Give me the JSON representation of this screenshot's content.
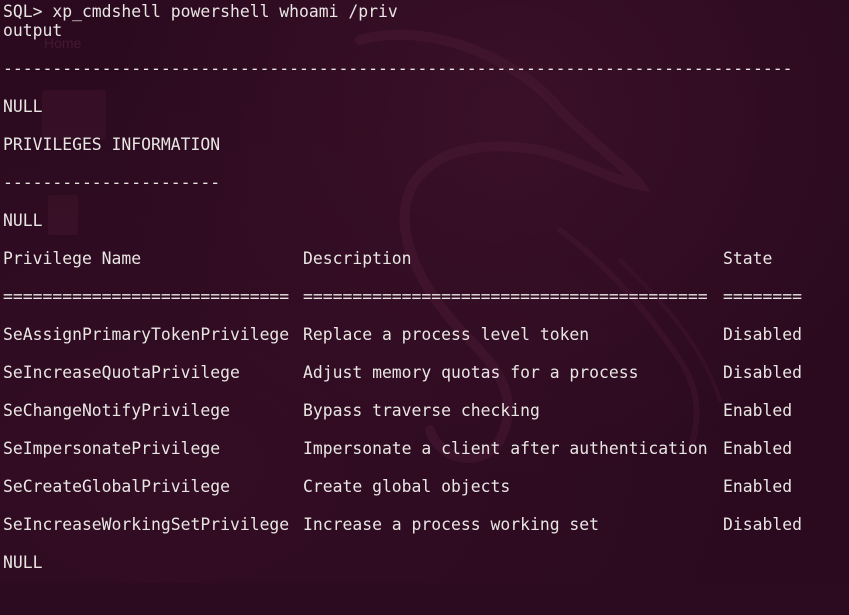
{
  "desktop": {
    "home_label": "Home"
  },
  "terminal": {
    "prompt": "SQL> xp_cmdshell powershell whoami /priv",
    "output_header": "output",
    "dash_long": "--------------------------------------------------------------------------------",
    "null_1": "NULL",
    "priv_info_title": "PRIVILEGES INFORMATION",
    "dash_short": "----------------------",
    "null_2": "NULL",
    "columns": {
      "name": "Privilege Name",
      "description": "Description",
      "state": "State"
    },
    "separators": {
      "name": "=============================",
      "description": "=========================================",
      "state": "========"
    },
    "rows": [
      {
        "name": "SeAssignPrimaryTokenPrivilege",
        "description": "Replace a process level token",
        "state": "Disabled"
      },
      {
        "name": "SeIncreaseQuotaPrivilege",
        "description": "Adjust memory quotas for a process",
        "state": "Disabled"
      },
      {
        "name": "SeChangeNotifyPrivilege",
        "description": "Bypass traverse checking",
        "state": "Enabled"
      },
      {
        "name": "SeImpersonatePrivilege",
        "description": "Impersonate a client after authentication",
        "state": "Enabled"
      },
      {
        "name": "SeCreateGlobalPrivilege",
        "description": "Create global objects",
        "state": "Enabled"
      },
      {
        "name": "SeIncreaseWorkingSetPrivilege",
        "description": "Increase a process working set",
        "state": "Disabled"
      }
    ],
    "null_3": "NULL"
  }
}
